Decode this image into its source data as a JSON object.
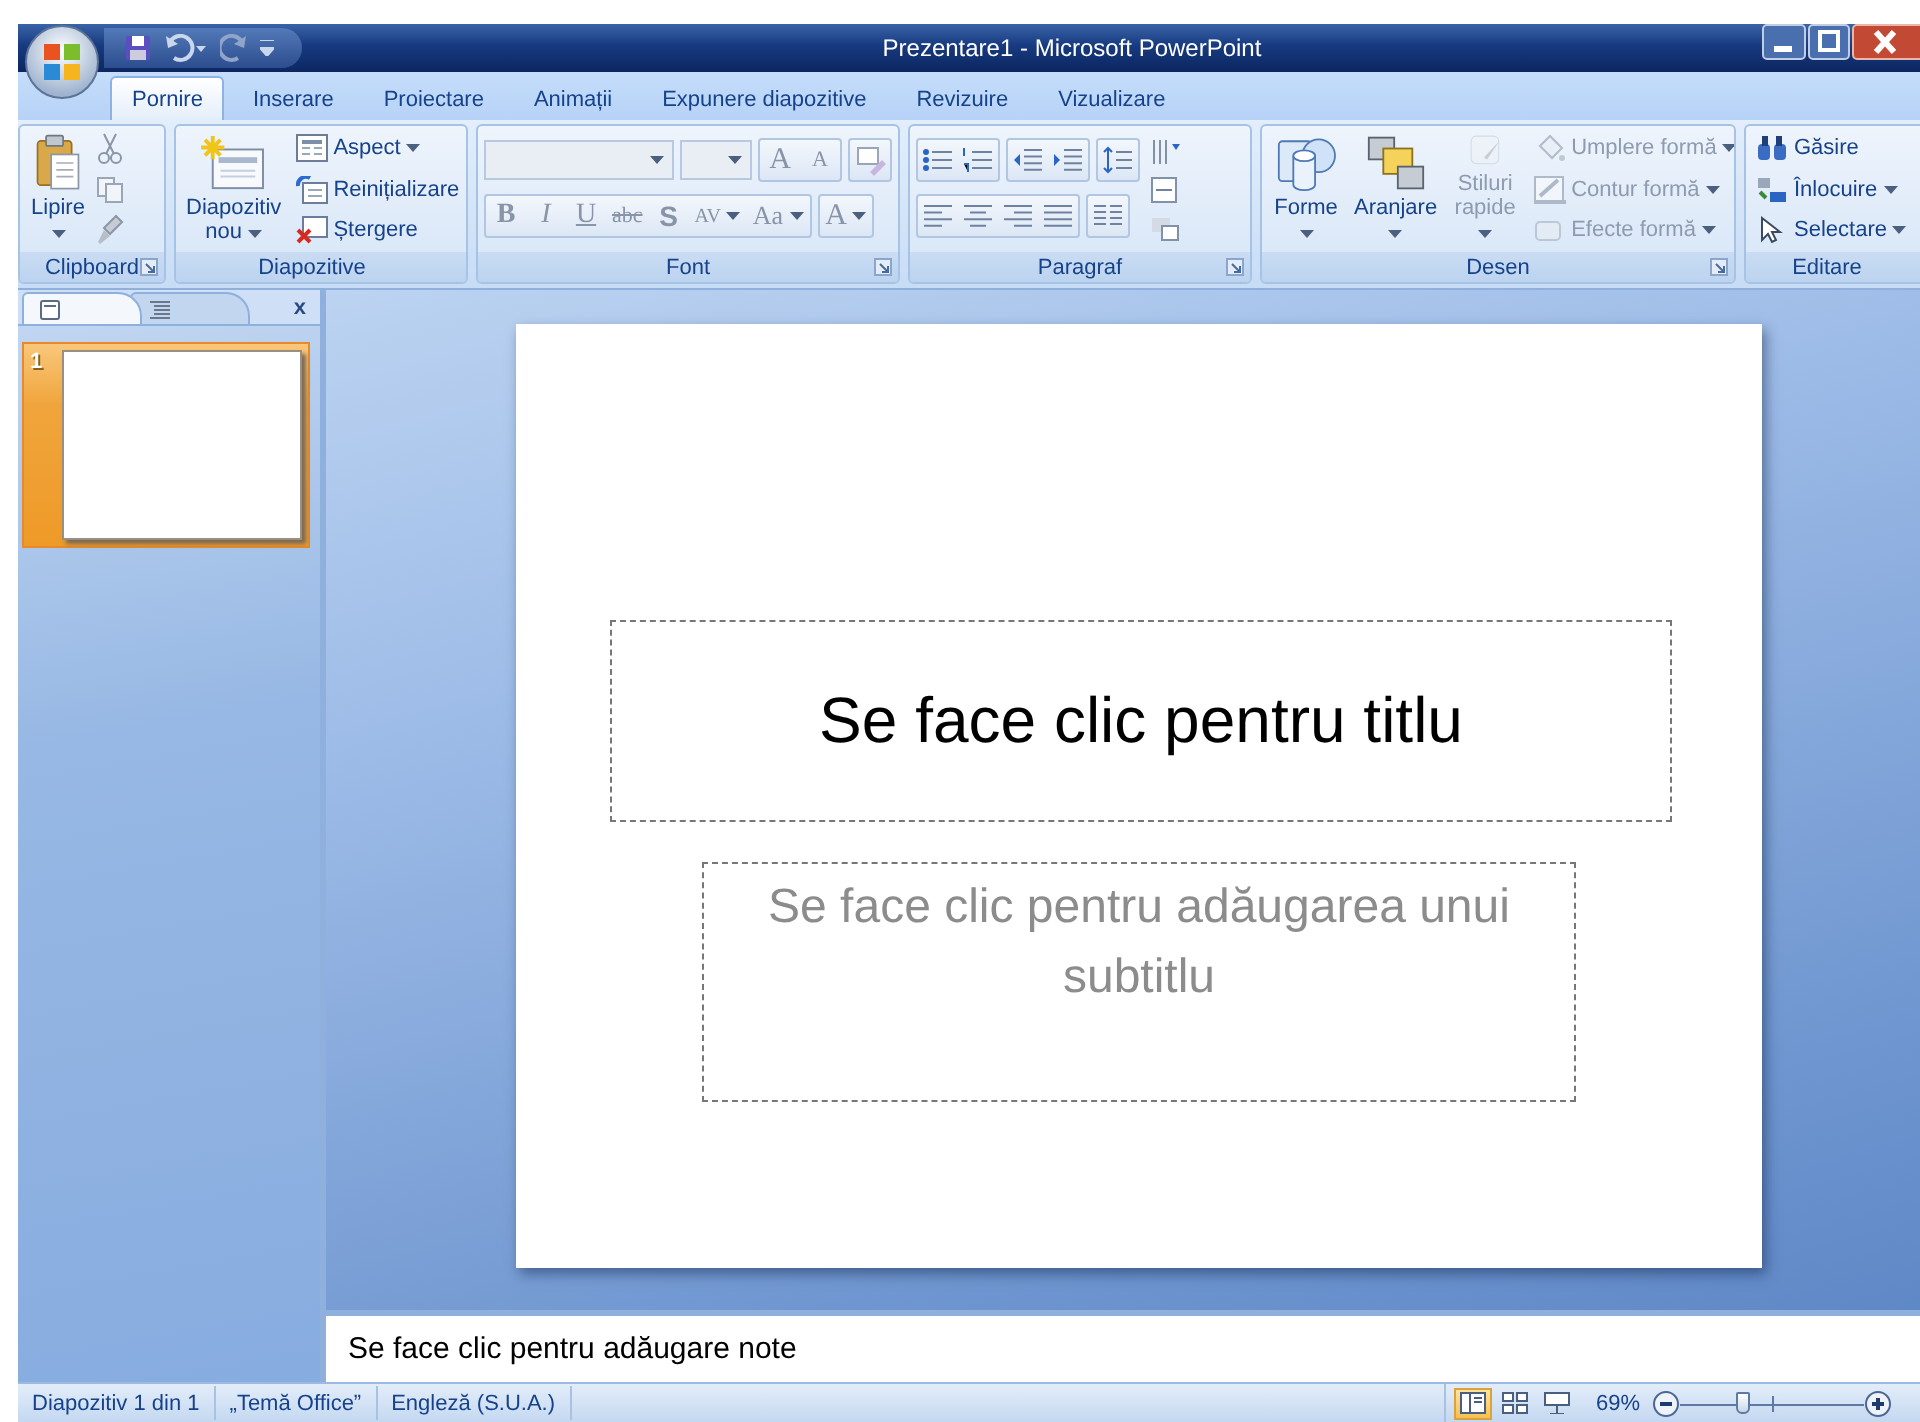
{
  "window": {
    "title": "Prezentare1 - Microsoft PowerPoint"
  },
  "tabs": [
    {
      "label": "Pornire",
      "selected": true
    },
    {
      "label": "Inserare",
      "selected": false
    },
    {
      "label": "Proiectare",
      "selected": false
    },
    {
      "label": "Animații",
      "selected": false
    },
    {
      "label": "Expunere diapozitive",
      "selected": false
    },
    {
      "label": "Revizuire",
      "selected": false
    },
    {
      "label": "Vizualizare",
      "selected": false
    }
  ],
  "ribbon": {
    "groups": [
      {
        "kind": "clipboard",
        "label": "Clipboard",
        "launcher": true,
        "large": [
          {
            "label": "Lipire",
            "dropdown": true,
            "disabled": false
          }
        ]
      },
      {
        "kind": "slides",
        "label": "Diapozitive",
        "launcher": false,
        "large": [
          {
            "label": "Diapozitiv nou",
            "dropdown": true,
            "disabled": false
          }
        ],
        "small": [
          {
            "label": "Aspect",
            "dropdown": true,
            "disabled": false
          },
          {
            "label": "Reinițializare",
            "dropdown": false,
            "disabled": false
          },
          {
            "label": "Ștergere",
            "dropdown": false,
            "disabled": false
          }
        ]
      },
      {
        "kind": "font",
        "label": "Font",
        "launcher": true,
        "buttons": [
          {
            "label": "A",
            "kind": "grow"
          },
          {
            "label": "A",
            "kind": "shrink"
          },
          {
            "label": "B",
            "kind": "bold"
          },
          {
            "label": "I",
            "kind": "italic"
          },
          {
            "label": "U",
            "kind": "underline"
          },
          {
            "label": "abc",
            "kind": "strike"
          },
          {
            "label": "S",
            "kind": "shadow"
          },
          {
            "label": "AV",
            "kind": "spacing"
          },
          {
            "label": "Aa",
            "kind": "case"
          },
          {
            "label": "A",
            "kind": "color"
          }
        ]
      },
      {
        "kind": "paragraph",
        "label": "Paragraf",
        "launcher": true
      },
      {
        "kind": "drawing",
        "label": "Desen",
        "launcher": true,
        "large": [
          {
            "label": "Forme",
            "dropdown": true,
            "disabled": false
          },
          {
            "label": "Aranjare",
            "dropdown": true,
            "disabled": false
          },
          {
            "label": "Stiluri rapide",
            "dropdown": true,
            "disabled": true
          }
        ],
        "small": [
          {
            "label": "Umplere formă",
            "dropdown": true,
            "disabled": true
          },
          {
            "label": "Contur formă",
            "dropdown": true,
            "disabled": true
          },
          {
            "label": "Efecte formă",
            "dropdown": true,
            "disabled": true
          }
        ]
      },
      {
        "kind": "editing",
        "label": "Editare",
        "launcher": false,
        "small": [
          {
            "label": "Găsire",
            "dropdown": false,
            "disabled": false
          },
          {
            "label": "Înlocuire",
            "dropdown": true,
            "disabled": false
          },
          {
            "label": "Selectare",
            "dropdown": true,
            "disabled": false
          }
        ]
      }
    ]
  },
  "slide_pane": {
    "tabs": [
      {
        "kind": "slides",
        "selected": true
      },
      {
        "kind": "outline",
        "selected": false
      }
    ],
    "close": "x",
    "thumbnails": [
      {
        "number": "1",
        "selected": true
      }
    ]
  },
  "slide": {
    "title": "Se face clic pentru titlu",
    "subtitle": "Se face clic pentru adăugarea unui subtitlu"
  },
  "notes": {
    "prompt": "Se face clic pentru adăugare note"
  },
  "status_bar": {
    "items": [
      "Diapozitiv 1 din 1",
      "„Temă Office”",
      "Engleză (S.U.A.)"
    ],
    "views": [
      {
        "kind": "normal",
        "selected": true
      },
      {
        "kind": "sorter",
        "selected": false
      },
      {
        "kind": "show",
        "selected": false
      }
    ],
    "zoom": {
      "reading": "69%",
      "level": 0.34
    }
  }
}
